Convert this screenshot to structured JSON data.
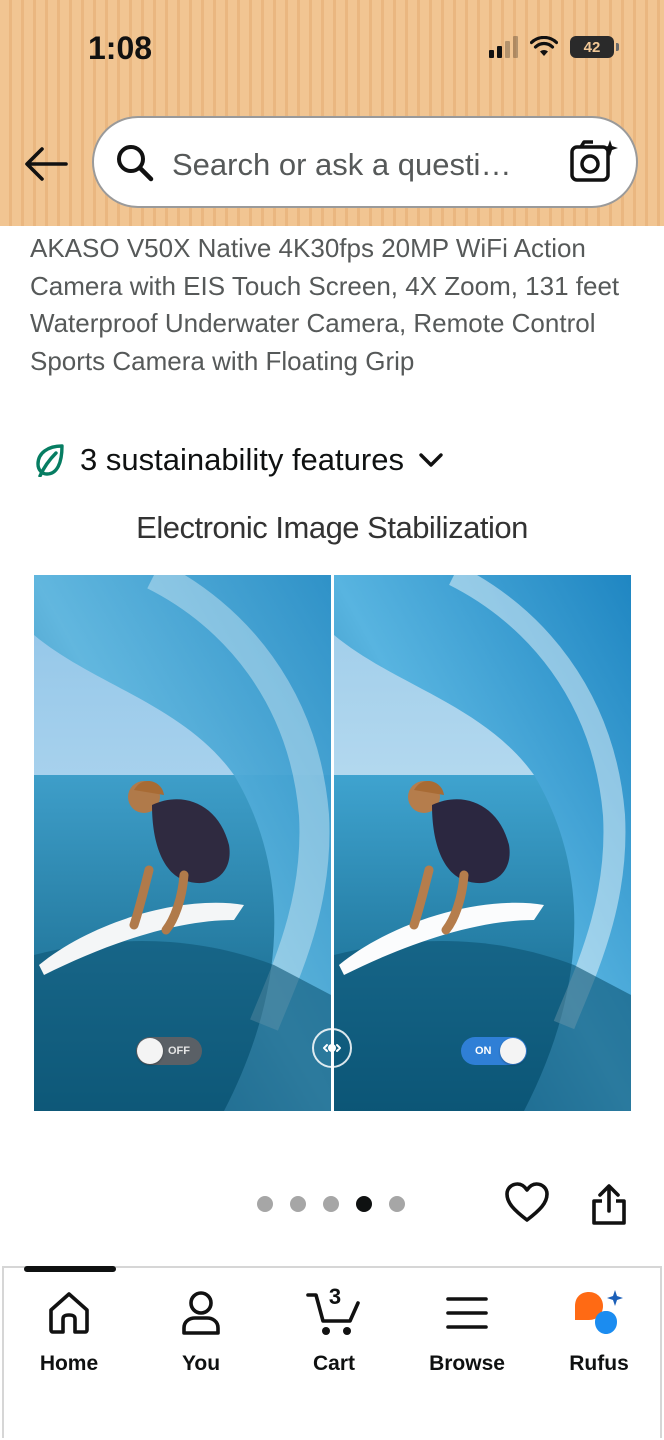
{
  "status_bar": {
    "time": "1:08",
    "battery": "42"
  },
  "search": {
    "placeholder": "Search or ask a questi…"
  },
  "product": {
    "title": "AKASO V50X Native 4K30fps 20MP WiFi Action Camera with EIS Touch Screen, 4X Zoom, 131 feet Waterproof Underwater Camera, Remote Control Sports Camera with Floating Grip",
    "sustainability": "3 sustainability features"
  },
  "image": {
    "title": "Electronic Image Stabilization",
    "toggle_off_label": "OFF",
    "toggle_on_label": "ON",
    "dots_total": 5,
    "dots_active_index": 3
  },
  "bottom_nav": {
    "items": [
      {
        "label": "Home",
        "icon": "home-icon"
      },
      {
        "label": "You",
        "icon": "person-icon"
      },
      {
        "label": "Cart",
        "icon": "cart-icon"
      },
      {
        "label": "Browse",
        "icon": "menu-icon"
      },
      {
        "label": "Rufus",
        "icon": "rufus-icon"
      }
    ],
    "cart_count": "3"
  },
  "colors": {
    "header_bg": "#f1c592",
    "sustainability_green": "#067d62",
    "toggle_on": "#2f7fd6",
    "rufus_orange": "#ff6a14",
    "rufus_blue": "#1b8cf0"
  }
}
